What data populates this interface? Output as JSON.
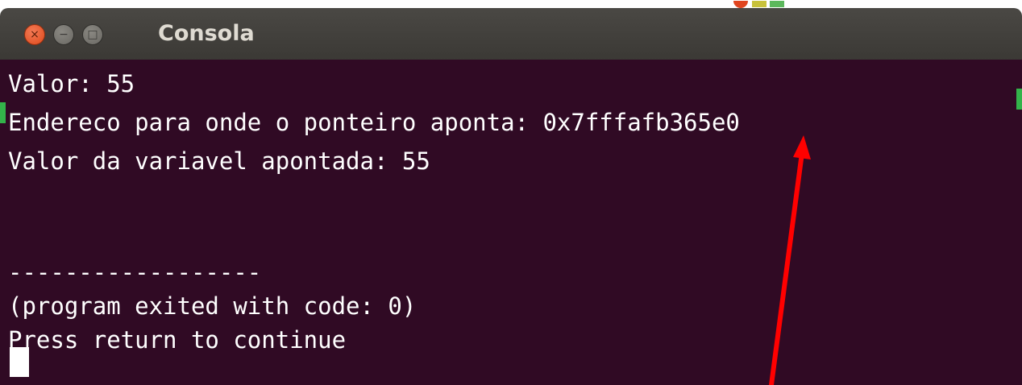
{
  "window": {
    "title": "Consola",
    "controls": {
      "close_glyph": "×",
      "minimize_glyph": "−",
      "maximize_glyph": "□"
    }
  },
  "terminal": {
    "lines": [
      "Valor: 55",
      "Endereco para onde o ponteiro aponta: 0x7fffafb365e0",
      "Valor da variavel apontada: 55",
      "",
      "",
      "------------------",
      "(program exited with code: 0)",
      "Press return to continue"
    ],
    "background_color": "#300a24",
    "text_color": "#ffffff"
  },
  "annotation": {
    "arrow_color": "#ff0000",
    "points_to": "0x7fffafb365e0"
  }
}
